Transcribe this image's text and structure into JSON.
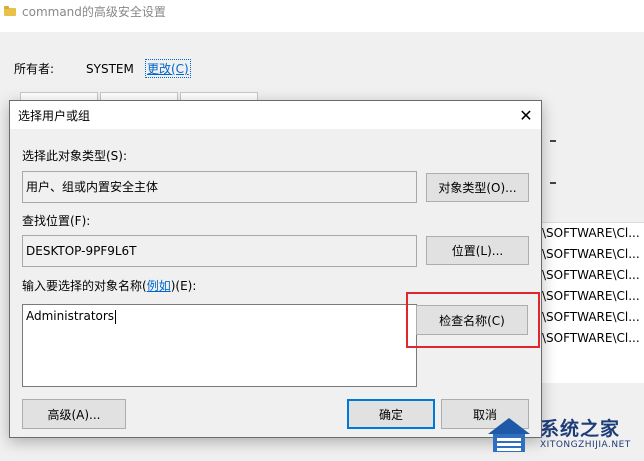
{
  "background_window": {
    "title": "command的高级安全设置",
    "owner_label": "所有者:",
    "owner_value": "SYSTEM",
    "owner_change": "更改(C)",
    "list_rows": [
      "\\SOFTWARE\\Cl...",
      "\\SOFTWARE\\Cl...",
      "\\SOFTWARE\\Cl...",
      "\\SOFTWARE\\Cl...",
      "\\SOFTWARE\\Cl...",
      "\\SOFTWARE\\Cl..."
    ]
  },
  "dialog": {
    "title": "选择用户或组",
    "object_type_label": "选择此对象类型(S):",
    "object_type_value": "用户、组或内置安全主体",
    "object_type_button": "对象类型(O)...",
    "location_label": "查找位置(F):",
    "location_value": "DESKTOP-9PF9L6T",
    "location_button": "位置(L)...",
    "names_label_prefix": "输入要选择的对象名称(",
    "names_label_link": "例如",
    "names_label_suffix": ")(E):",
    "names_value": "Administrators",
    "check_names_button": "检查名称(C)",
    "advanced_button": "高级(A)...",
    "ok_button": "确定",
    "cancel_button": "取消"
  },
  "watermark": {
    "title": "系统之家",
    "subtitle": "XITONGZHIJIA.NET"
  },
  "colors": {
    "highlight": "#e0262f",
    "link": "#0066cc",
    "accent": "#0078d7"
  }
}
